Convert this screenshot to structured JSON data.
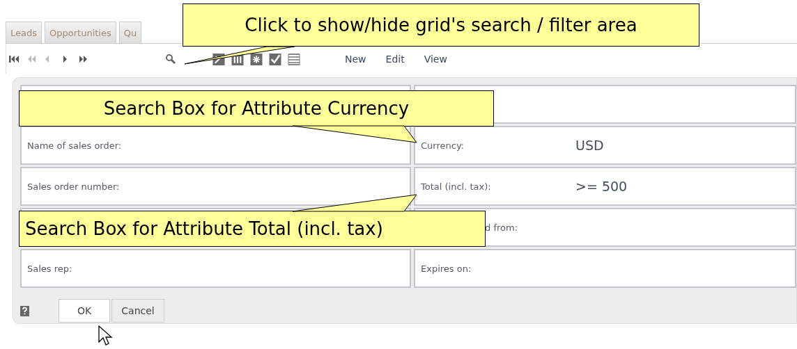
{
  "tabs": [
    {
      "label": "Leads"
    },
    {
      "label": "Opportunities"
    },
    {
      "label": "Qu"
    }
  ],
  "toolbar": {
    "nav": [
      {
        "kind": "first",
        "disabled": false
      },
      {
        "kind": "fast-back",
        "disabled": true
      },
      {
        "kind": "back",
        "disabled": true
      },
      {
        "kind": "forward",
        "disabled": false
      },
      {
        "kind": "last",
        "disabled": false
      }
    ],
    "menu": [
      "New",
      "Edit",
      "View"
    ]
  },
  "form": {
    "rows": [
      {
        "cells": [
          {},
          {}
        ]
      },
      {
        "cells": [
          {
            "label": "Name of sales order:"
          },
          {
            "label": "Currency:",
            "value": "USD"
          }
        ]
      },
      {
        "cells": [
          {
            "label": "Sales order number:"
          },
          {
            "label": "Total (incl. tax):",
            "value": ">= 500"
          }
        ]
      },
      {
        "cells": [
          {},
          {
            "label": "d from:",
            "covered": true
          }
        ]
      },
      {
        "cells": [
          {
            "label": "Sales rep:"
          },
          {
            "label": "Expires on:"
          }
        ]
      }
    ],
    "buttons": [
      {
        "label": "OK",
        "default": true
      },
      {
        "label": "Cancel",
        "default": false
      }
    ]
  },
  "callouts": [
    {
      "text": "Click to show/hide grid's search / filter area"
    },
    {
      "text": "Search Box for Attribute Currency"
    },
    {
      "text": "Search Box for Attribute Total (incl. tax)"
    }
  ]
}
